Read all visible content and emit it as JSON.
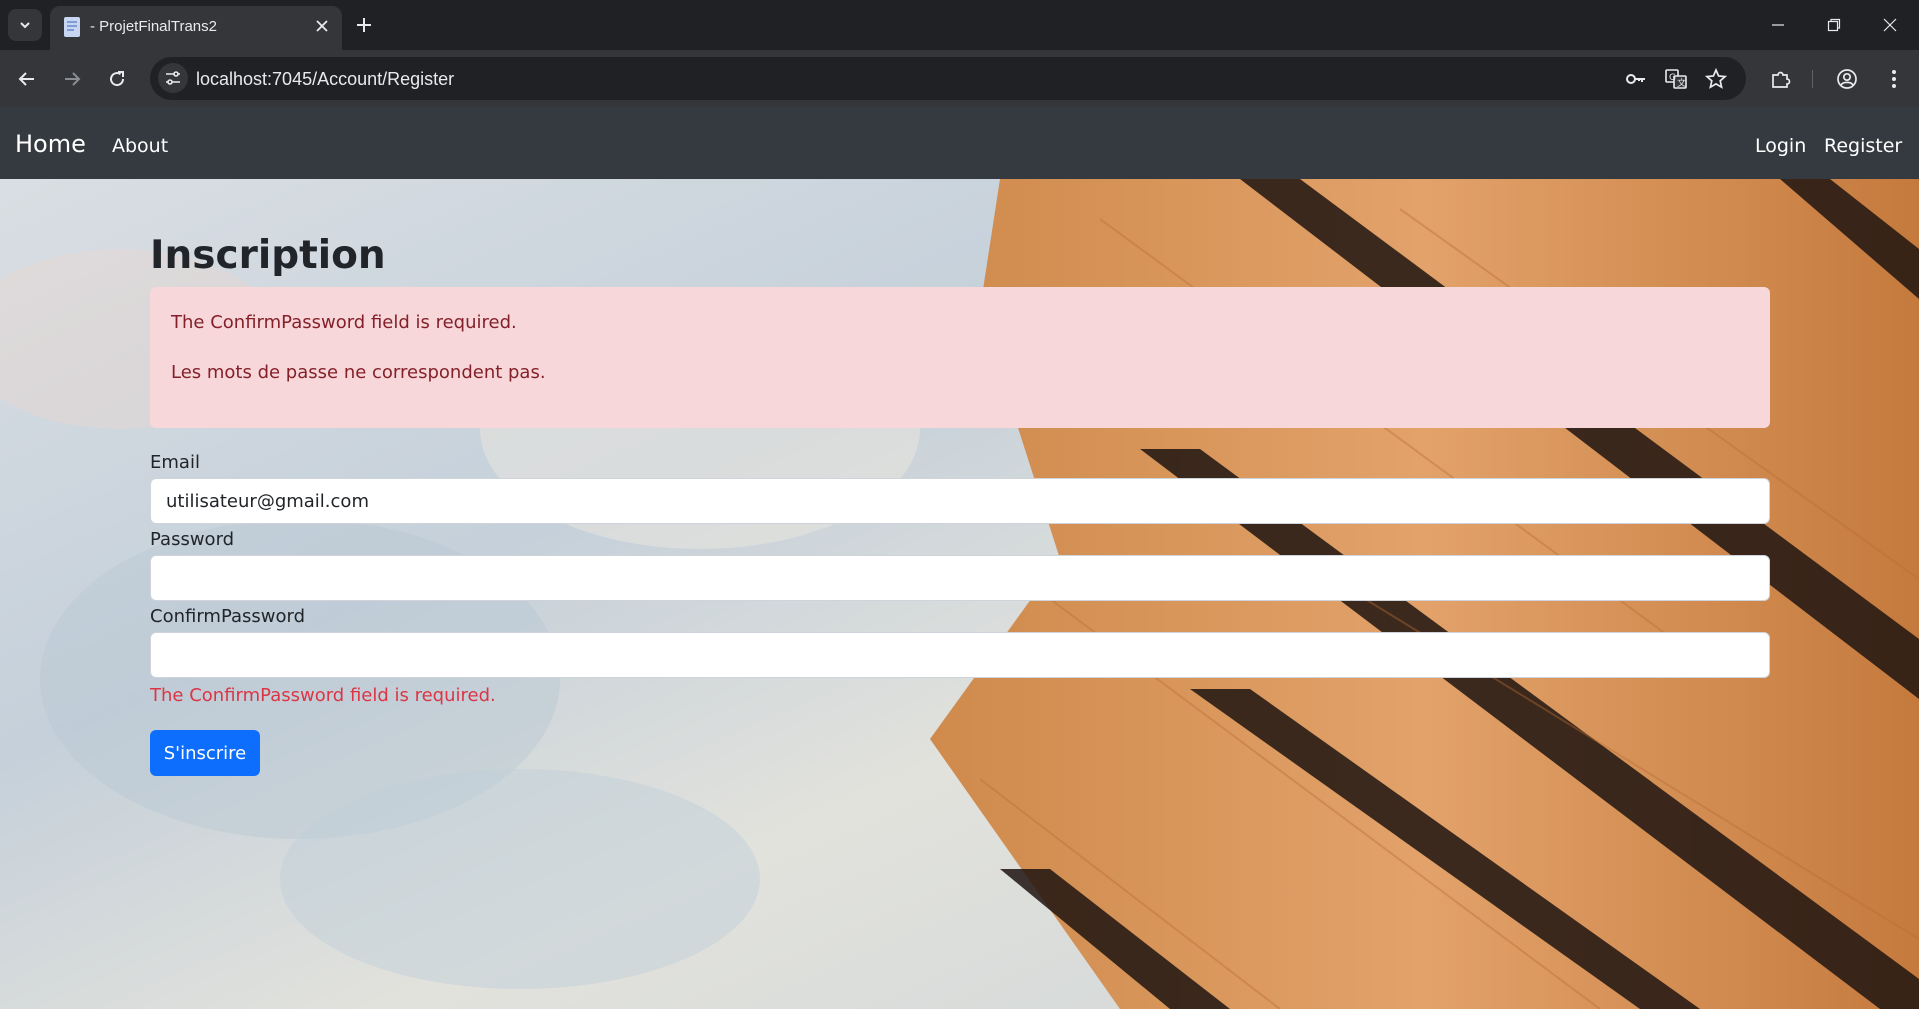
{
  "browser": {
    "tab_title": "- ProjetFinalTrans2",
    "url": "localhost:7045/Account/Register"
  },
  "navbar": {
    "brand": "Home",
    "about": "About",
    "login": "Login",
    "register": "Register"
  },
  "page": {
    "heading": "Inscription",
    "alert_messages": [
      "The ConfirmPassword field is required.",
      "Les mots de passe ne correspondent pas."
    ],
    "email_label": "Email",
    "email_value": "utilisateur@gmail.com",
    "password_label": "Password",
    "password_value": "",
    "confirm_label": "ConfirmPassword",
    "confirm_value": "",
    "confirm_error": "The ConfirmPassword field is required.",
    "submit_label": "S'inscrire"
  },
  "colors": {
    "navbar_bg": "#343a40",
    "alert_bg": "#f8d7da",
    "alert_text": "#842029",
    "error_text": "#dc3545",
    "primary_button": "#0d6efd"
  },
  "icons": {
    "tab_list": "chevron-down-icon",
    "favicon": "page-icon",
    "tab_close": "close-icon",
    "new_tab": "plus-icon",
    "back": "arrow-left-icon",
    "forward": "arrow-right-icon",
    "reload": "reload-icon",
    "site_info": "tune-icon",
    "password_manager": "key-icon",
    "translate": "translate-icon",
    "bookmark": "star-icon",
    "extensions": "puzzle-icon",
    "profile": "profile-icon",
    "menu": "kebab-menu-icon"
  }
}
